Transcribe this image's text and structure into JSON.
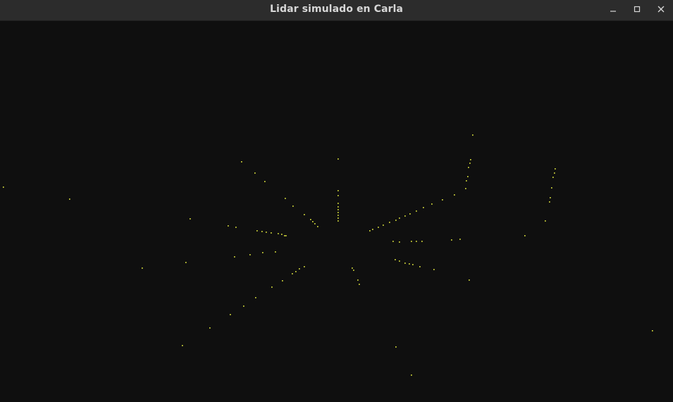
{
  "window": {
    "title": "Lidar simulado en Carla",
    "controls": [
      {
        "name": "minimize-button",
        "icon": "minimize-icon"
      },
      {
        "name": "maximize-button",
        "icon": "maximize-icon"
      },
      {
        "name": "close-button",
        "icon": "close-icon"
      }
    ]
  },
  "colors": {
    "titlebar": "#2c2c2c",
    "title_text": "#d6d6d6",
    "background": "#0f0f0f",
    "point": "#e8f040"
  }
}
